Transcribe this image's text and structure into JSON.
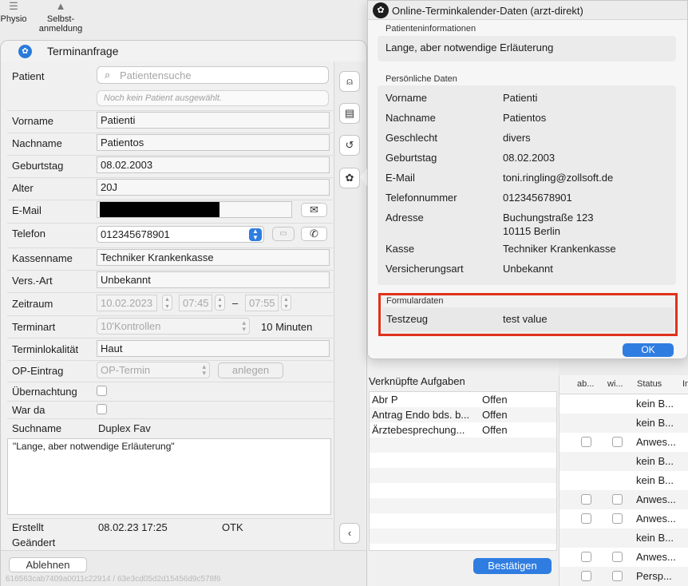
{
  "toolbar": {
    "items": [
      {
        "label": "Physio",
        "icon": "list-icon"
      },
      {
        "label": "Selbst-\nanmeldung",
        "icon": "person-icon"
      }
    ]
  },
  "dialog": {
    "title": "Terminanfrage",
    "patient_label": "Patient",
    "search_placeholder": "Patientensuche",
    "no_patient": "Noch kein Patient ausgewählt.",
    "fields": {
      "vorname": {
        "label": "Vorname",
        "value": "Patienti"
      },
      "nachname": {
        "label": "Nachname",
        "value": "Patientos"
      },
      "geburtstag": {
        "label": "Geburtstag",
        "value": "08.02.2003"
      },
      "alter": {
        "label": "Alter",
        "value": "20J"
      },
      "email": {
        "label": "E-Mail",
        "value": ""
      },
      "telefon": {
        "label": "Telefon",
        "value": "012345678901"
      },
      "kassenname": {
        "label": "Kassenname",
        "value": "Techniker Krankenkasse"
      },
      "versart": {
        "label": "Vers.-Art",
        "value": "Unbekannt"
      },
      "zeitraum": {
        "label": "Zeitraum",
        "date": "10.02.2023",
        "from": "07:45",
        "dash": "–",
        "to": "07:55"
      },
      "terminart": {
        "label": "Terminart",
        "value": "10'Kontrollen",
        "duration": "10 Minuten"
      },
      "terminlokalitaet": {
        "label": "Terminlokalität",
        "value": "Haut"
      },
      "op_eintrag": {
        "label": "OP-Eintrag",
        "value": "OP-Termin",
        "button": "anlegen"
      },
      "uebernachtung": {
        "label": "Übernachtung"
      },
      "war_da": {
        "label": "War da"
      },
      "suchname": {
        "label": "Suchname",
        "value": "Duplex Fav"
      }
    },
    "note": "\"Lange, aber notwendige Erläuterung\"",
    "erstellt": {
      "label": "Erstellt",
      "value": "08.02.23 17:25",
      "user": "OTK"
    },
    "geaendert": {
      "label": "Geändert"
    },
    "reject_button": "Ablehnen",
    "footer_id": "616563cab7409a0011c22914 / 63e3cd05d2d15456d9c578f6"
  },
  "linked_tasks": {
    "title": "Verknüpfte Aufgaben",
    "rows": [
      {
        "name": "Abr P",
        "status": "Offen"
      },
      {
        "name": "Antrag Endo bds. b...",
        "status": "Offen"
      },
      {
        "name": "Ärztebesprechung...",
        "status": "Offen"
      }
    ],
    "confirm_button": "Bestätigen"
  },
  "bg_table": {
    "headers": [
      "ab...",
      "wi...",
      "Status",
      "In"
    ],
    "rows": [
      "kein B...",
      "kein B...",
      "Anwes...",
      "kein B...",
      "kein B...",
      "Anwes...",
      "Anwes...",
      "kein B...",
      "Anwes...",
      "Persp..."
    ]
  },
  "popup": {
    "title": "Online-Terminkalender-Daten (arzt-direkt)",
    "patient_info_title": "Patienteninformationen",
    "patient_info_text": "Lange, aber notwendige Erläuterung",
    "personal_title": "Persönliche Daten",
    "personal": [
      {
        "key": "Vorname",
        "value": "Patienti"
      },
      {
        "key": "Nachname",
        "value": "Patientos"
      },
      {
        "key": "Geschlecht",
        "value": "divers"
      },
      {
        "key": "Geburtstag",
        "value": "08.02.2003"
      },
      {
        "key": "E-Mail",
        "value": "toni.ringling@zollsoft.de"
      },
      {
        "key": "Telefonnummer",
        "value": "012345678901"
      },
      {
        "key": "Adresse",
        "value": "Buchungstraße 123",
        "value2": "10115 Berlin"
      },
      {
        "key": "Kasse",
        "value": "Techniker Krankenkasse"
      },
      {
        "key": "Versicherungsart",
        "value": "Unbekannt"
      }
    ],
    "form_title": "Formulardaten",
    "form_key": "Testzeug",
    "form_value": "test value",
    "ok_button": "OK"
  },
  "colors": {
    "accent": "#2f7de1",
    "highlight": "#e0321c"
  }
}
